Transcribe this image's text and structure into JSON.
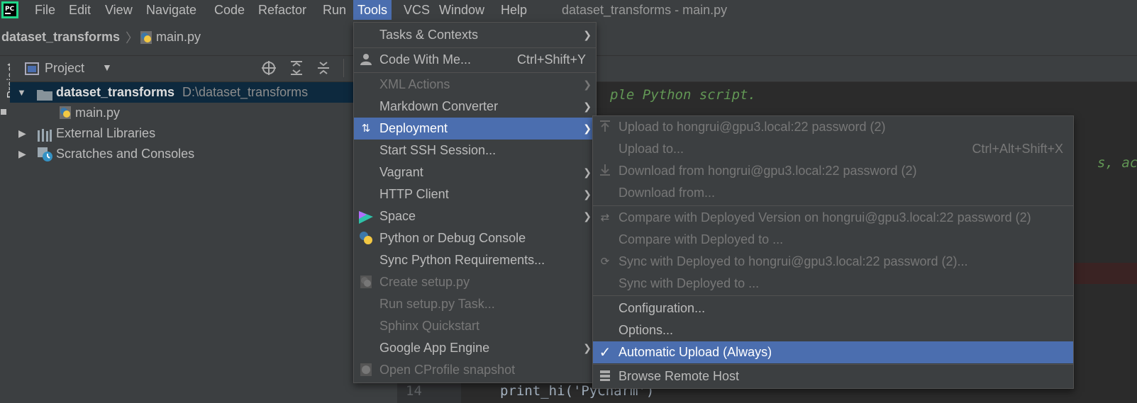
{
  "menubar": {
    "items": [
      "File",
      "Edit",
      "View",
      "Navigate",
      "Code",
      "Refactor",
      "Run",
      "Tools",
      "VCS",
      "Window",
      "Help"
    ],
    "window_title": "dataset_transforms - main.py"
  },
  "breadcrumb": {
    "project": "dataset_transforms",
    "file": "main.py"
  },
  "project_panel": {
    "title": "Project",
    "vertical_tab": "Project",
    "tree": [
      {
        "label": "dataset_transforms",
        "path": "D:\\dataset_transforms"
      },
      {
        "label": "main.py"
      },
      {
        "label": "External Libraries"
      },
      {
        "label": "Scratches and Consoles"
      }
    ]
  },
  "editor": {
    "line1": "ple Python script.",
    "line2": "s, ac",
    "line_number": "14",
    "code_line": "print_hi('PyCharm')"
  },
  "tools_menu": [
    {
      "label": "Tasks & Contexts",
      "submenu": true
    },
    {
      "label": "Code With Me...",
      "shortcut": "Ctrl+Shift+Y"
    },
    {
      "label": "XML Actions",
      "disabled": true,
      "submenu": true
    },
    {
      "label": "Markdown Converter",
      "submenu": true
    },
    {
      "label": "Deployment",
      "submenu": true,
      "highlighted": true
    },
    {
      "label": "Start SSH Session..."
    },
    {
      "label": "Vagrant",
      "submenu": true
    },
    {
      "label": "HTTP Client",
      "submenu": true
    },
    {
      "label": "Space",
      "submenu": true
    },
    {
      "label": "Python or Debug Console"
    },
    {
      "label": "Sync Python Requirements..."
    },
    {
      "label": "Create setup.py",
      "disabled": true
    },
    {
      "label": "Run setup.py Task...",
      "disabled": true
    },
    {
      "label": "Sphinx Quickstart",
      "disabled": true
    },
    {
      "label": "Google App Engine",
      "submenu": true
    },
    {
      "label": "Open CProfile snapshot",
      "disabled": true
    }
  ],
  "deployment_menu": [
    {
      "label": "Upload to hongrui@gpu3.local:22 password (2)",
      "disabled": true
    },
    {
      "label": "Upload to...",
      "disabled": true,
      "shortcut": "Ctrl+Alt+Shift+X"
    },
    {
      "label": "Download from hongrui@gpu3.local:22 password (2)",
      "disabled": true
    },
    {
      "label": "Download from...",
      "disabled": true
    },
    {
      "label": "Compare with Deployed Version on hongrui@gpu3.local:22 password (2)",
      "disabled": true
    },
    {
      "label": "Compare with Deployed to ...",
      "disabled": true
    },
    {
      "label": "Sync with Deployed to hongrui@gpu3.local:22 password (2)...",
      "disabled": true
    },
    {
      "label": "Sync with Deployed to ...",
      "disabled": true
    },
    {
      "label": "Configuration..."
    },
    {
      "label": "Options..."
    },
    {
      "label": "Automatic Upload (Always)",
      "checked": true,
      "highlighted": true
    },
    {
      "label": "Browse Remote Host"
    }
  ],
  "colors": {
    "highlight": "#4b6eaf",
    "panel": "#3c3f41",
    "editor": "#2b2b2b",
    "selection": "#0d293e"
  }
}
